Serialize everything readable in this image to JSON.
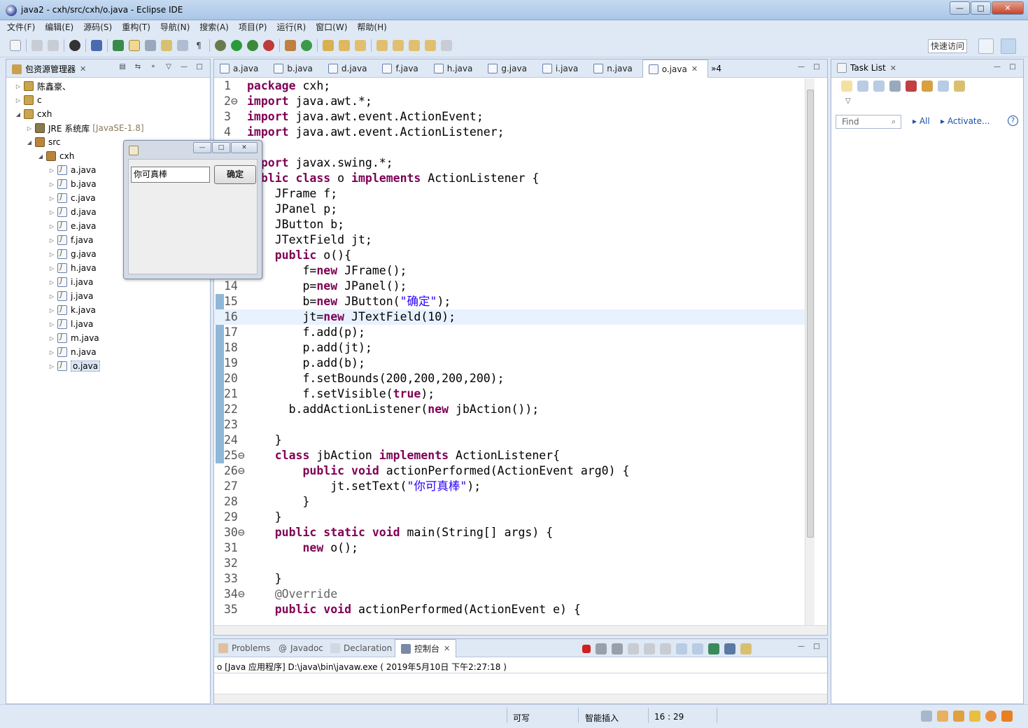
{
  "window": {
    "title": "java2 - cxh/src/cxh/o.java - Eclipse IDE"
  },
  "menu": [
    "文件(F)",
    "编辑(E)",
    "源码(S)",
    "重构(T)",
    "导航(N)",
    "搜索(A)",
    "项目(P)",
    "运行(R)",
    "窗口(W)",
    "帮助(H)"
  ],
  "toolbar": {
    "quick_access": "快速访问"
  },
  "package_explorer": {
    "title": "包资源管理器",
    "projects": [
      {
        "label": "陈鑫豪、"
      },
      {
        "label": "c"
      },
      {
        "label": "cxh"
      }
    ],
    "jre": {
      "label": "JRE 系统库",
      "detail": "[JavaSE-1.8]"
    },
    "src": "src",
    "package": "cxh",
    "files": [
      "a.java",
      "b.java",
      "c.java",
      "d.java",
      "e.java",
      "f.java",
      "g.java",
      "h.java",
      "i.java",
      "j.java",
      "k.java",
      "l.java",
      "m.java",
      "n.java",
      "o.java"
    ]
  },
  "editor": {
    "tabs": [
      "a.java",
      "b.java",
      "d.java",
      "f.java",
      "h.java",
      "g.java",
      "i.java",
      "n.java",
      "o.java"
    ],
    "overflow": "»4",
    "lines": [
      {
        "n": "1",
        "code": "package cxh;"
      },
      {
        "n": "2⊖",
        "code": "import java.awt.*;"
      },
      {
        "n": "3",
        "code": "import java.awt.event.ActionEvent;"
      },
      {
        "n": "4",
        "code": "import java.awt.event.ActionListener;"
      },
      {
        "n": "",
        "code": ""
      },
      {
        "n": "",
        "code": "import javax.swing.*;"
      },
      {
        "n": "",
        "code": "public class o implements ActionListener {"
      },
      {
        "n": "",
        "code": "    JFrame f;"
      },
      {
        "n": "",
        "code": "    JPanel p;"
      },
      {
        "n": "",
        "code": "    JButton b;"
      },
      {
        "n": "",
        "code": "    JTextField jt;"
      },
      {
        "n": "",
        "code": "    public o(){"
      },
      {
        "n": "",
        "code": "        f=new JFrame();"
      },
      {
        "n": "14",
        "code": "        p=new JPanel();"
      },
      {
        "n": "15",
        "code": "        b=new JButton(\"确定\");"
      },
      {
        "n": "16",
        "code": "        jt=new JTextField(10);"
      },
      {
        "n": "17",
        "code": "        f.add(p);"
      },
      {
        "n": "18",
        "code": "        p.add(jt);"
      },
      {
        "n": "19",
        "code": "        p.add(b);"
      },
      {
        "n": "20",
        "code": "        f.setBounds(200,200,200,200);"
      },
      {
        "n": "21",
        "code": "        f.setVisible(true);"
      },
      {
        "n": "22",
        "code": "      b.addActionListener(new jbAction());"
      },
      {
        "n": "23",
        "code": ""
      },
      {
        "n": "24",
        "code": "    }"
      },
      {
        "n": "25⊖",
        "code": "    class jbAction implements ActionListener{"
      },
      {
        "n": "26⊖",
        "code": "        public void actionPerformed(ActionEvent arg0) {"
      },
      {
        "n": "27",
        "code": "            jt.setText(\"你可真棒\");"
      },
      {
        "n": "28",
        "code": "        }"
      },
      {
        "n": "29",
        "code": "    }"
      },
      {
        "n": "30⊖",
        "code": "    public static void main(String[] args) {"
      },
      {
        "n": "31",
        "code": "        new o();"
      },
      {
        "n": "32",
        "code": ""
      },
      {
        "n": "33",
        "code": "    }"
      },
      {
        "n": "34⊖",
        "code": "    @Override"
      },
      {
        "n": "35",
        "code": "    public void actionPerformed(ActionEvent e) {"
      }
    ]
  },
  "task_list": {
    "title": "Task List",
    "find_placeholder": "Find",
    "filter_all": "All",
    "filter_activate": "Activate..."
  },
  "console": {
    "tabs": [
      "Problems",
      "Javadoc",
      "Declaration",
      "控制台"
    ],
    "output": "o [Java 应用程序] D:\\java\\bin\\javaw.exe ( 2019年5月10日 下午2:27:18 )"
  },
  "status": {
    "writable": "可写",
    "insert_mode": "智能插入",
    "position": "16 : 29"
  },
  "swing_window": {
    "text_value": "你可真棒",
    "button_label": "确定"
  }
}
